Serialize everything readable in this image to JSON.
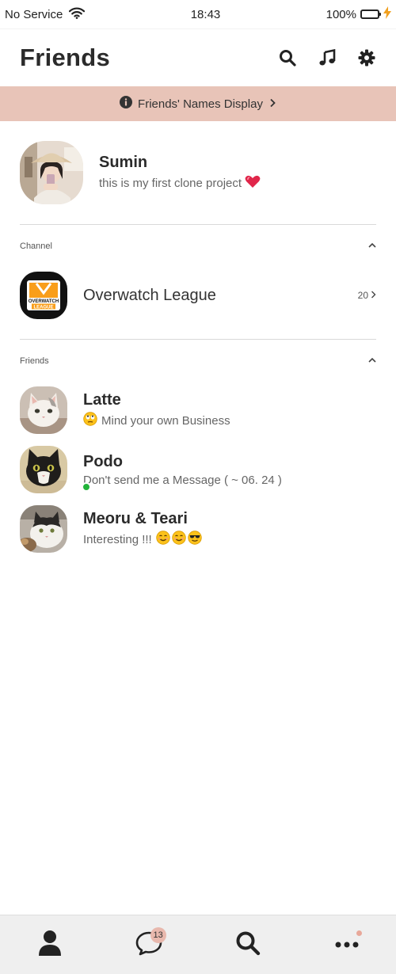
{
  "status_bar": {
    "carrier": "No Service",
    "time": "18:43",
    "battery": "100%"
  },
  "header": {
    "title": "Friends",
    "icons": [
      "search-icon",
      "music-icon",
      "gear-icon"
    ]
  },
  "banner": {
    "label": "Friends' Names Display",
    "icons": [
      "info-icon",
      "chevron-right-icon"
    ]
  },
  "profile": {
    "name": "Sumin",
    "status": "this is my first clone project",
    "status_emoji": "heart-icon"
  },
  "channel_section": {
    "label": "Channel",
    "items": [
      {
        "name": "Overwatch League",
        "count": "20",
        "logo_text_top": "OVERWATCH",
        "logo_text_bottom": "LEAGUE"
      }
    ]
  },
  "friends_section": {
    "label": "Friends",
    "items": [
      {
        "name": "Latte",
        "emoji": "rolling-eyes-emoji",
        "status": "Mind your own Business",
        "online": false
      },
      {
        "name": "Podo",
        "status": "Don't send me a Message ( ~ 06. 24 )",
        "online": true
      },
      {
        "name": "Meoru & Teari",
        "status": "Interesting !!!",
        "emojis": [
          "smile-emoji",
          "smile-emoji",
          "sunglasses-emoji"
        ],
        "online": false
      }
    ]
  },
  "tab_bar": {
    "tabs": [
      "person-icon",
      "chat-icon",
      "search-icon",
      "more-icon"
    ],
    "chat_badge": "13"
  },
  "colors": {
    "banner_bg": "#e8c4b8",
    "online": "#23b43a",
    "badge": "#e8b8ad",
    "tab_bar_bg": "#efefef"
  }
}
